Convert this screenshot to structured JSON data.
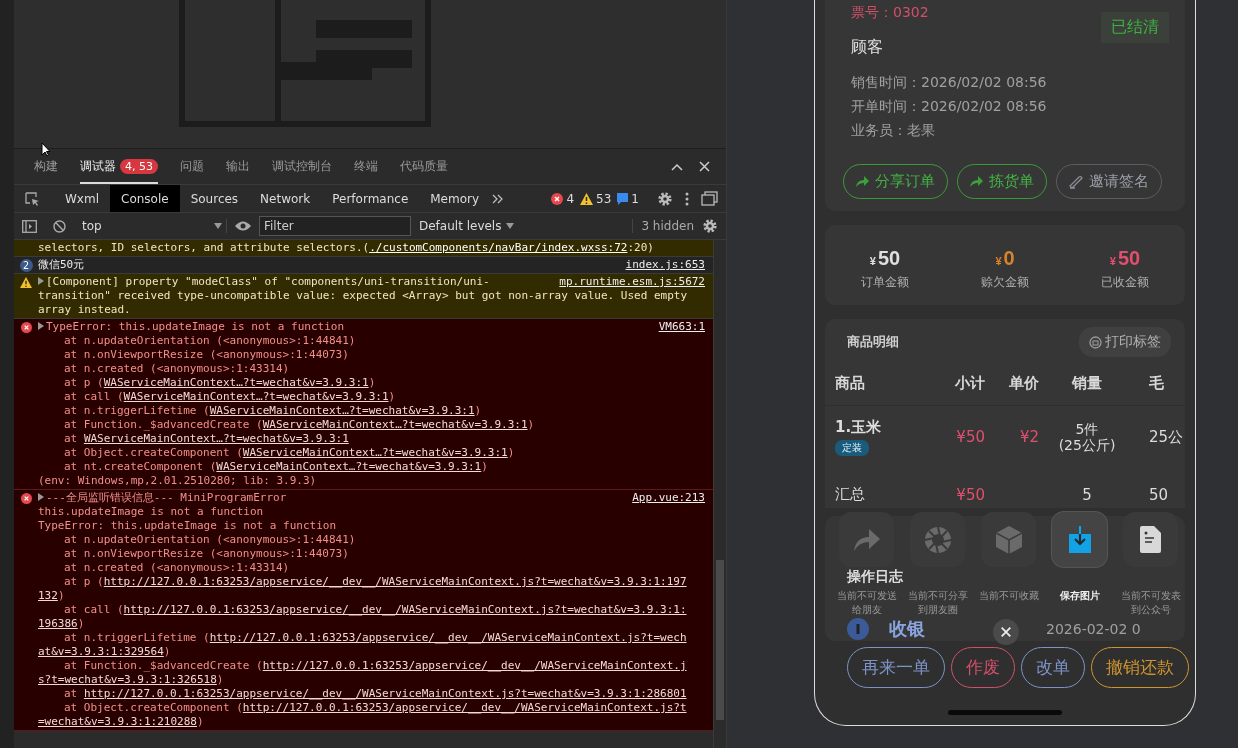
{
  "panel_tabs": [
    {
      "label": "构建",
      "selected": false
    },
    {
      "label": "调试器",
      "selected": true,
      "badge": "4, 53"
    },
    {
      "label": "问题",
      "selected": false
    },
    {
      "label": "输出",
      "selected": false
    },
    {
      "label": "调试控制台",
      "selected": false
    },
    {
      "label": "终端",
      "selected": false
    },
    {
      "label": "代码质量",
      "selected": false
    }
  ],
  "devtools_tabs": [
    {
      "label": "Wxml",
      "selected": false
    },
    {
      "label": "Console",
      "selected": true
    },
    {
      "label": "Sources",
      "selected": false
    },
    {
      "label": "Network",
      "selected": false
    },
    {
      "label": "Performance",
      "selected": false
    },
    {
      "label": "Memory",
      "selected": false
    }
  ],
  "counters": [
    {
      "kind": "error",
      "count": "4"
    },
    {
      "kind": "warning",
      "count": "53"
    },
    {
      "kind": "info",
      "count": "1"
    }
  ],
  "console_toolbar": {
    "context": "top",
    "filter_placeholder": "Filter",
    "levels": "Default levels",
    "hidden": "3 hidden"
  },
  "entries": [
    {
      "kind": "warning",
      "icon": false,
      "collapsed": false,
      "lines": [
        {
          "kind": "text",
          "parts": [
            {
              "text": "selectors, ID selectors, and attribute selectors.(",
              "link": false
            },
            {
              "text": "./customComponents/navBar/index.wxss:72",
              "link": true
            },
            {
              "text": ":20)",
              "link": false
            }
          ]
        }
      ]
    },
    {
      "kind": "log",
      "icon": true,
      "collapsed": false,
      "count": "2",
      "source": "index.js:653",
      "lines": [
        {
          "kind": "text",
          "parts": [
            {
              "text": "微信50元",
              "link": false
            }
          ]
        }
      ]
    },
    {
      "kind": "warning",
      "icon": true,
      "collapsed": true,
      "source": "mp.runtime.esm.js:5672",
      "lines": [
        {
          "kind": "text",
          "parts": [
            {
              "text": "[Component] property \"modeClass\" of \"components/uni-transition/uni-",
              "link": false
            }
          ]
        },
        {
          "kind": "text",
          "parts": [
            {
              "text": "transition\" received type-uncompatible value: expected <Array> but got non-array value. Used empty",
              "link": false
            }
          ]
        },
        {
          "kind": "text",
          "parts": [
            {
              "text": "array instead.",
              "link": false
            }
          ]
        }
      ]
    },
    {
      "kind": "error",
      "icon": true,
      "collapsed": true,
      "source": "VM663:1",
      "lines": [
        {
          "kind": "text",
          "parts": [
            {
              "text": "TypeError: this.updateImage is not a function",
              "link": false
            }
          ]
        },
        {
          "kind": "frame",
          "parts": [
            {
              "text": "at n.updateOrientation (<anonymous>:1:44841)",
              "link": false
            }
          ]
        },
        {
          "kind": "frame",
          "parts": [
            {
              "text": "at n.onViewportResize (<anonymous>:1:44073)",
              "link": false
            }
          ]
        },
        {
          "kind": "frame",
          "parts": [
            {
              "text": "at n.created (<anonymous>:1:43314)",
              "link": false
            }
          ]
        },
        {
          "kind": "frame",
          "parts": [
            {
              "text": "at p (",
              "link": false
            },
            {
              "text": "WAServiceMainContext…?t=wechat&v=3.9.3:1",
              "link": true
            },
            {
              "text": ")",
              "link": false
            }
          ]
        },
        {
          "kind": "frame",
          "parts": [
            {
              "text": "at call (",
              "link": false
            },
            {
              "text": "WAServiceMainContext…?t=wechat&v=3.9.3:1",
              "link": true
            },
            {
              "text": ")",
              "link": false
            }
          ]
        },
        {
          "kind": "frame",
          "parts": [
            {
              "text": "at n.triggerLifetime (",
              "link": false
            },
            {
              "text": "WAServiceMainContext…?t=wechat&v=3.9.3:1",
              "link": true
            },
            {
              "text": ")",
              "link": false
            }
          ]
        },
        {
          "kind": "frame",
          "parts": [
            {
              "text": "at Function._$advancedCreate (",
              "link": false
            },
            {
              "text": "WAServiceMainContext…?t=wechat&v=3.9.3:1",
              "link": true
            },
            {
              "text": ")",
              "link": false
            }
          ]
        },
        {
          "kind": "frame",
          "parts": [
            {
              "text": "at ",
              "link": false
            },
            {
              "text": "WAServiceMainContext…?t=wechat&v=3.9.3:1",
              "link": true
            }
          ]
        },
        {
          "kind": "frame",
          "parts": [
            {
              "text": "at Object.createComponent (",
              "link": false
            },
            {
              "text": "WAServiceMainContext…?t=wechat&v=3.9.3:1",
              "link": true
            },
            {
              "text": ")",
              "link": false
            }
          ]
        },
        {
          "kind": "frame",
          "parts": [
            {
              "text": "at nt.createComponent (",
              "link": false
            },
            {
              "text": "WAServiceMainContext…?t=wechat&v=3.9.3:1",
              "link": true
            },
            {
              "text": ")",
              "link": false
            }
          ]
        },
        {
          "kind": "text",
          "parts": [
            {
              "text": "(env: Windows,mp,2.01.2510280; lib: 3.9.3)",
              "link": false
            }
          ]
        }
      ]
    },
    {
      "kind": "error",
      "icon": true,
      "collapsed": true,
      "source": "App.vue:213",
      "lines": [
        {
          "kind": "text",
          "parts": [
            {
              "text": "---全局监听错误信息--- MiniProgramError",
              "link": false
            }
          ]
        },
        {
          "kind": "text",
          "parts": [
            {
              "text": "this.updateImage is not a function",
              "link": false
            }
          ]
        },
        {
          "kind": "text",
          "parts": [
            {
              "text": "TypeError: this.updateImage is not a function",
              "link": false
            }
          ]
        },
        {
          "kind": "frame",
          "parts": [
            {
              "text": "at n.updateOrientation (<anonymous>:1:44841)",
              "link": false
            }
          ]
        },
        {
          "kind": "frame",
          "parts": [
            {
              "text": "at n.onViewportResize (<anonymous>:1:44073)",
              "link": false
            }
          ]
        },
        {
          "kind": "frame",
          "parts": [
            {
              "text": "at n.created (<anonymous>:1:43314)",
              "link": false
            }
          ]
        },
        {
          "kind": "frame",
          "parts": [
            {
              "text": "at p (",
              "link": false
            },
            {
              "text": "http://127.0.0.1:63253/appservice/__dev__/WAServiceMainContext.js?t=wechat&v=3.9.3:1:197",
              "link": true
            }
          ]
        },
        {
          "kind": "text",
          "parts": [
            {
              "text": "132",
              "link": true
            },
            {
              "text": ")",
              "link": false
            }
          ]
        },
        {
          "kind": "frame",
          "parts": [
            {
              "text": "at call (",
              "link": false
            },
            {
              "text": "http://127.0.0.1:63253/appservice/__dev__/WAServiceMainContext.js?t=wechat&v=3.9.3:1:",
              "link": true
            }
          ]
        },
        {
          "kind": "text",
          "parts": [
            {
              "text": "196386",
              "link": true
            },
            {
              "text": ")",
              "link": false
            }
          ]
        },
        {
          "kind": "frame",
          "parts": [
            {
              "text": "at n.triggerLifetime (",
              "link": false
            },
            {
              "text": "http://127.0.0.1:63253/appservice/__dev__/WAServiceMainContext.js?t=wech",
              "link": true
            }
          ]
        },
        {
          "kind": "text",
          "parts": [
            {
              "text": "at&v=3.9.3:1:329564",
              "link": true
            },
            {
              "text": ")",
              "link": false
            }
          ]
        },
        {
          "kind": "frame",
          "parts": [
            {
              "text": "at Function._$advancedCreate (",
              "link": false
            },
            {
              "text": "http://127.0.0.1:63253/appservice/__dev__/WAServiceMainContext.j",
              "link": true
            }
          ]
        },
        {
          "kind": "text",
          "parts": [
            {
              "text": "s?t=wechat&v=3.9.3:1:326518",
              "link": true
            },
            {
              "text": ")",
              "link": false
            }
          ]
        },
        {
          "kind": "frame",
          "parts": [
            {
              "text": "at ",
              "link": false
            },
            {
              "text": "http://127.0.0.1:63253/appservice/__dev__/WAServiceMainContext.js?t=wechat&v=3.9.3:1:286801",
              "link": true
            }
          ]
        },
        {
          "kind": "frame",
          "parts": [
            {
              "text": "at Object.createComponent (",
              "link": false
            },
            {
              "text": "http://127.0.0.1:63253/appservice/__dev__/WAServiceMainContext.js?t",
              "link": true
            }
          ]
        },
        {
          "kind": "text",
          "parts": [
            {
              "text": "=wechat&v=3.9.3:1:210288",
              "link": true
            },
            {
              "text": ")",
              "link": false
            }
          ]
        }
      ]
    }
  ],
  "phone": {
    "ticket": "票号：0302",
    "status": "已结清",
    "customer": "顾客",
    "info": [
      "销售时间：2026/02/02 08:56",
      "开单时间：2026/02/02 08:56",
      "业务员：老果"
    ],
    "actions": [
      {
        "label": "分享订单",
        "kind": "share"
      },
      {
        "label": "拣货单",
        "kind": "share"
      },
      {
        "label": "邀请签名",
        "kind": "sign"
      }
    ],
    "amounts": [
      {
        "currency": "¥",
        "value": "50",
        "label": "订单金额",
        "color": "#e0e0e0"
      },
      {
        "currency": "¥",
        "value": "0",
        "label": "赊欠金额",
        "color": "#d9822b"
      },
      {
        "currency": "¥",
        "value": "50",
        "label": "已收金额",
        "color": "#e0506e"
      }
    ],
    "goods": {
      "title": "商品明细",
      "print": "打印标签",
      "columns": [
        "商品",
        "小计",
        "单价",
        "销量",
        "毛"
      ],
      "rows": [
        {
          "name": "1.玉米",
          "tag": "定装",
          "subtotal": "¥50",
          "price": "¥2",
          "quantity": "5件",
          "quantity_note": "(25公斤)",
          "weight": "25公"
        }
      ],
      "total": {
        "name": "汇总",
        "subtotal": "¥50",
        "quantity": "5",
        "weight": "50"
      }
    },
    "log": {
      "title": "操作日志",
      "action": "收银",
      "time": "2026-02-02 0"
    },
    "buttons": [
      {
        "label": "再来一单",
        "color": "#7d93c8"
      },
      {
        "label": "作废",
        "color": "#d0506a"
      },
      {
        "label": "改单",
        "color": "#7d93c8"
      },
      {
        "label": "撤销还款",
        "color": "#d0952f"
      }
    ]
  },
  "share_sheet": {
    "items": [
      {
        "kind": "forward",
        "label": "当前不可发送给朋友",
        "enabled": false
      },
      {
        "kind": "moments",
        "label": "当前不可分享到朋友圈",
        "enabled": false
      },
      {
        "kind": "favorite",
        "label": "当前不可收藏",
        "enabled": false
      },
      {
        "kind": "save",
        "label": "保存图片",
        "enabled": true
      },
      {
        "kind": "article",
        "label": "当前不可发表到公众号",
        "enabled": false
      }
    ]
  }
}
